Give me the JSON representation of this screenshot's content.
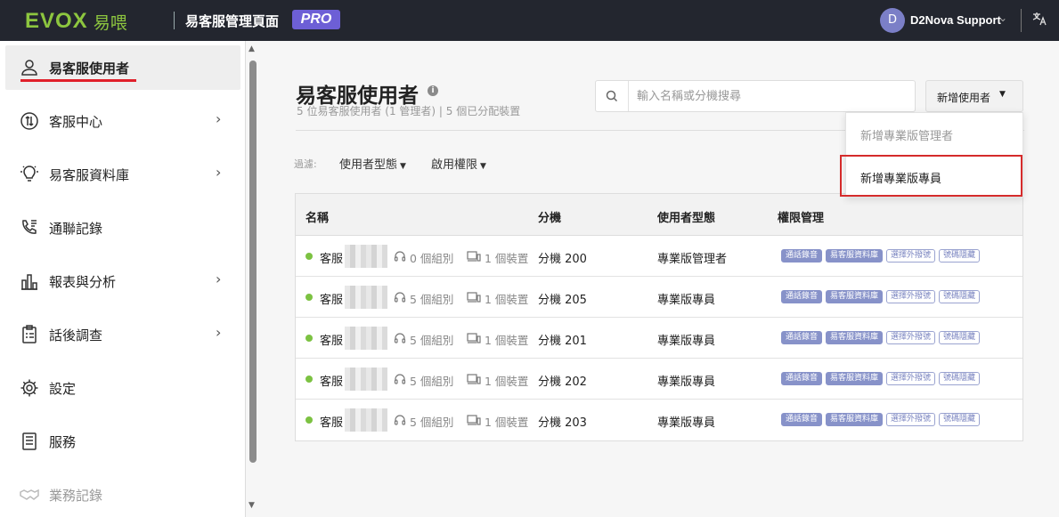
{
  "header": {
    "logo_text": "EVOX",
    "logo_zh": "易喂",
    "app_title": "易客服管理頁面",
    "pro_badge": "PRO",
    "user_initial": "D",
    "user_name": "D2Nova Support"
  },
  "sidebar": {
    "items": [
      {
        "label": "易客服使用者",
        "icon": "user-icon",
        "active": true,
        "chevron": false
      },
      {
        "label": "客服中心",
        "icon": "routing-icon",
        "active": false,
        "chevron": true
      },
      {
        "label": "易客服資料庫",
        "icon": "lightbulb-icon",
        "active": false,
        "chevron": true
      },
      {
        "label": "通聯記錄",
        "icon": "phone-log-icon",
        "active": false,
        "chevron": false
      },
      {
        "label": "報表與分析",
        "icon": "bar-chart-icon",
        "active": false,
        "chevron": true
      },
      {
        "label": "話後調查",
        "icon": "clipboard-icon",
        "active": false,
        "chevron": true
      },
      {
        "label": "設定",
        "icon": "gear-icon",
        "active": false,
        "chevron": false
      },
      {
        "label": "服務",
        "icon": "document-icon",
        "active": false,
        "chevron": false
      },
      {
        "label": "業務記錄",
        "icon": "handshake-icon",
        "active": false,
        "chevron": false
      }
    ]
  },
  "main": {
    "title": "易客服使用者",
    "subtitle": "5 位易客服使用者 (1 管理者) | 5 個已分配裝置",
    "search_placeholder": "輸入名稱或分機搜尋",
    "add_button": "新增使用者",
    "filter_label": "過濾:",
    "filters": [
      "使用者型態",
      "啟用權限"
    ],
    "dropdown": {
      "items": [
        "新增專業版管理者",
        "新增專業版專員"
      ],
      "disabled_index": 0,
      "highlighted_index": 1
    },
    "table": {
      "columns": [
        "名稱",
        "分機",
        "使用者型態",
        "權限管理"
      ],
      "badge_labels": [
        "通話錄音",
        "易客服資料庫",
        "選擇外撥號",
        "號碼隱藏"
      ],
      "rows": [
        {
          "name": "客服",
          "groups": "0 個組別",
          "devices": "1 個裝置",
          "ext": "分機 200",
          "type": "專業版管理者",
          "badges_on": [
            true,
            true,
            false,
            false
          ]
        },
        {
          "name": "客服",
          "groups": "5 個組別",
          "devices": "1 個裝置",
          "ext": "分機 205",
          "type": "專業版專員",
          "badges_on": [
            true,
            true,
            false,
            false
          ]
        },
        {
          "name": "客服",
          "groups": "5 個組別",
          "devices": "1 個裝置",
          "ext": "分機 201",
          "type": "專業版專員",
          "badges_on": [
            true,
            true,
            false,
            false
          ]
        },
        {
          "name": "客服",
          "groups": "5 個組別",
          "devices": "1 個裝置",
          "ext": "分機 202",
          "type": "專業版專員",
          "badges_on": [
            true,
            true,
            false,
            false
          ]
        },
        {
          "name": "客服",
          "groups": "5 個組別",
          "devices": "1 個裝置",
          "ext": "分機 203",
          "type": "專業版專員",
          "badges_on": [
            true,
            true,
            false,
            false
          ]
        }
      ]
    }
  }
}
